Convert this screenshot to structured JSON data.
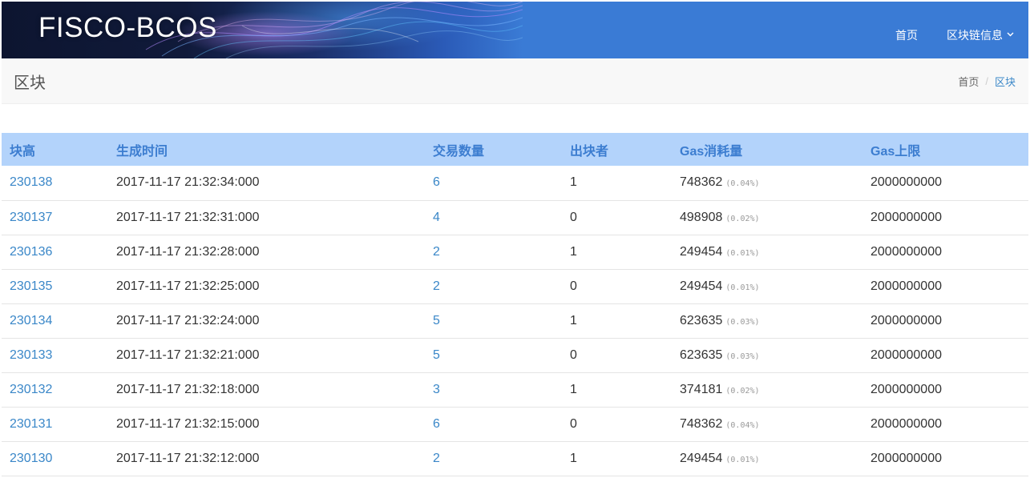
{
  "header": {
    "logo": "FISCO-BCOS",
    "nav": [
      {
        "label": "首页"
      },
      {
        "label": "区块链信息",
        "chevron": "chevron-down-icon"
      }
    ],
    "color": "#3a7bd5"
  },
  "breadcrumb_bar": {
    "title": "区块",
    "home": "首页",
    "separator": "/",
    "current": "区块"
  },
  "table": {
    "columns": [
      "块高",
      "生成时间",
      "交易数量",
      "出块者",
      "Gas消耗量",
      "Gas上限"
    ],
    "header_color": "#b3d3fb",
    "rows": [
      {
        "height": "230138",
        "time": "2017-11-17 21:32:34:000",
        "tx": "6",
        "miner": "1",
        "gas": "748362",
        "pct": "(0.04%)",
        "limit": "2000000000"
      },
      {
        "height": "230137",
        "time": "2017-11-17 21:32:31:000",
        "tx": "4",
        "miner": "0",
        "gas": "498908",
        "pct": "(0.02%)",
        "limit": "2000000000"
      },
      {
        "height": "230136",
        "time": "2017-11-17 21:32:28:000",
        "tx": "2",
        "miner": "1",
        "gas": "249454",
        "pct": "(0.01%)",
        "limit": "2000000000"
      },
      {
        "height": "230135",
        "time": "2017-11-17 21:32:25:000",
        "tx": "2",
        "miner": "0",
        "gas": "249454",
        "pct": "(0.01%)",
        "limit": "2000000000"
      },
      {
        "height": "230134",
        "time": "2017-11-17 21:32:24:000",
        "tx": "5",
        "miner": "1",
        "gas": "623635",
        "pct": "(0.03%)",
        "limit": "2000000000"
      },
      {
        "height": "230133",
        "time": "2017-11-17 21:32:21:000",
        "tx": "5",
        "miner": "0",
        "gas": "623635",
        "pct": "(0.03%)",
        "limit": "2000000000"
      },
      {
        "height": "230132",
        "time": "2017-11-17 21:32:18:000",
        "tx": "3",
        "miner": "1",
        "gas": "374181",
        "pct": "(0.02%)",
        "limit": "2000000000"
      },
      {
        "height": "230131",
        "time": "2017-11-17 21:32:15:000",
        "tx": "6",
        "miner": "0",
        "gas": "748362",
        "pct": "(0.04%)",
        "limit": "2000000000"
      },
      {
        "height": "230130",
        "time": "2017-11-17 21:32:12:000",
        "tx": "2",
        "miner": "1",
        "gas": "249454",
        "pct": "(0.01%)",
        "limit": "2000000000"
      }
    ]
  }
}
